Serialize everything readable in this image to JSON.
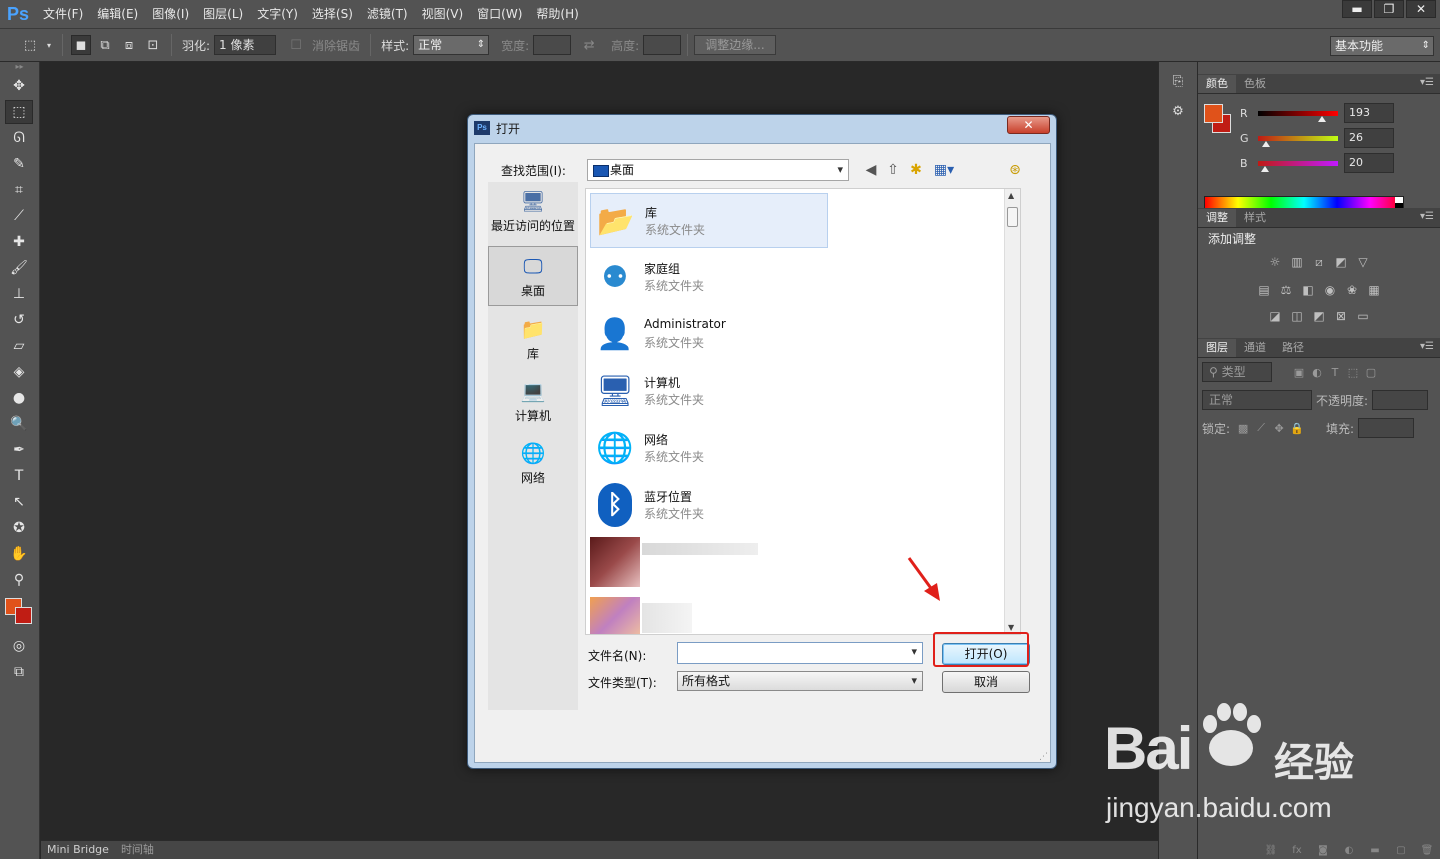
{
  "app": {
    "logo": "Ps"
  },
  "menu": [
    "文件(F)",
    "编辑(E)",
    "图像(I)",
    "图层(L)",
    "文字(Y)",
    "选择(S)",
    "滤镜(T)",
    "视图(V)",
    "窗口(W)",
    "帮助(H)"
  ],
  "window_controls": {
    "minimize": "▬",
    "restore": "❐",
    "close": "✕"
  },
  "options_bar": {
    "feather_label": "羽化:",
    "feather_value": "1 像素",
    "antialias_label": "消除锯齿",
    "style_label": "样式:",
    "style_value": "正常",
    "width_label": "宽度:",
    "height_label": "高度:",
    "refine_edge": "调整边缘...",
    "workspace": "基本功能"
  },
  "bottom_tabs": [
    "Mini Bridge",
    "时间轴"
  ],
  "color_panel": {
    "tabs": [
      "颜色",
      "色板"
    ],
    "fg_color": "#e0521a",
    "bg_color": "#c01d14",
    "channels": [
      {
        "label": "R",
        "value": "193",
        "gradient": "linear-gradient(to right,#000,#f00)"
      },
      {
        "label": "G",
        "value": "26",
        "gradient": "linear-gradient(to right,#c01a14,#c0ff14)"
      },
      {
        "label": "B",
        "value": "20",
        "gradient": "linear-gradient(to right,#c01a14,#c01aff)"
      }
    ]
  },
  "adjust_panel": {
    "tabs": [
      "调整",
      "样式"
    ],
    "title": "添加调整"
  },
  "layers_panel": {
    "tabs": [
      "图层",
      "通道",
      "路径"
    ],
    "kind_filter": "类型",
    "blend_mode": "正常",
    "opacity_label": "不透明度:",
    "lock_label": "锁定:",
    "fill_label": "填充:"
  },
  "dialog": {
    "title": "打开",
    "close": "✕",
    "lookin_label": "查找范围(I):",
    "lookin_value": "桌面",
    "places": [
      {
        "label": "最近访问的位置",
        "icon": "recent-places-icon",
        "glyph": "🖥"
      },
      {
        "label": "桌面",
        "icon": "desktop-icon",
        "glyph": "🖵"
      },
      {
        "label": "库",
        "icon": "libraries-icon",
        "glyph": "📁"
      },
      {
        "label": "计算机",
        "icon": "computer-icon",
        "glyph": "💻"
      },
      {
        "label": "网络",
        "icon": "network-icon",
        "glyph": "🌐"
      }
    ],
    "files": [
      {
        "name": "库",
        "type": "系统文件夹",
        "icon": "libraries-icon",
        "glyph": "📂",
        "color": "#e8c050"
      },
      {
        "name": "家庭组",
        "type": "系统文件夹",
        "icon": "homegroup-icon",
        "glyph": "⚉",
        "color": "#2a8ad0"
      },
      {
        "name": "Administrator",
        "type": "系统文件夹",
        "icon": "user-folder-icon",
        "glyph": "👤",
        "color": "#c8a040"
      },
      {
        "name": "计算机",
        "type": "系统文件夹",
        "icon": "computer-icon",
        "glyph": "🖥",
        "color": "#2a60b0"
      },
      {
        "name": "网络",
        "type": "系统文件夹",
        "icon": "network-icon",
        "glyph": "🌐",
        "color": "#2a8040"
      },
      {
        "name": "蓝牙位置",
        "type": "系统文件夹",
        "icon": "bluetooth-icon",
        "glyph": "ᛒ",
        "color": "#1060c0"
      }
    ],
    "filename_label": "文件名(N):",
    "filename_value": "",
    "filetype_label": "文件类型(T):",
    "filetype_value": "所有格式",
    "open_button": "打开(O)",
    "cancel_button": "取消"
  },
  "watermark": {
    "brand": "Bai",
    "brand2": "经验",
    "url": "jingyan.baidu.com"
  }
}
